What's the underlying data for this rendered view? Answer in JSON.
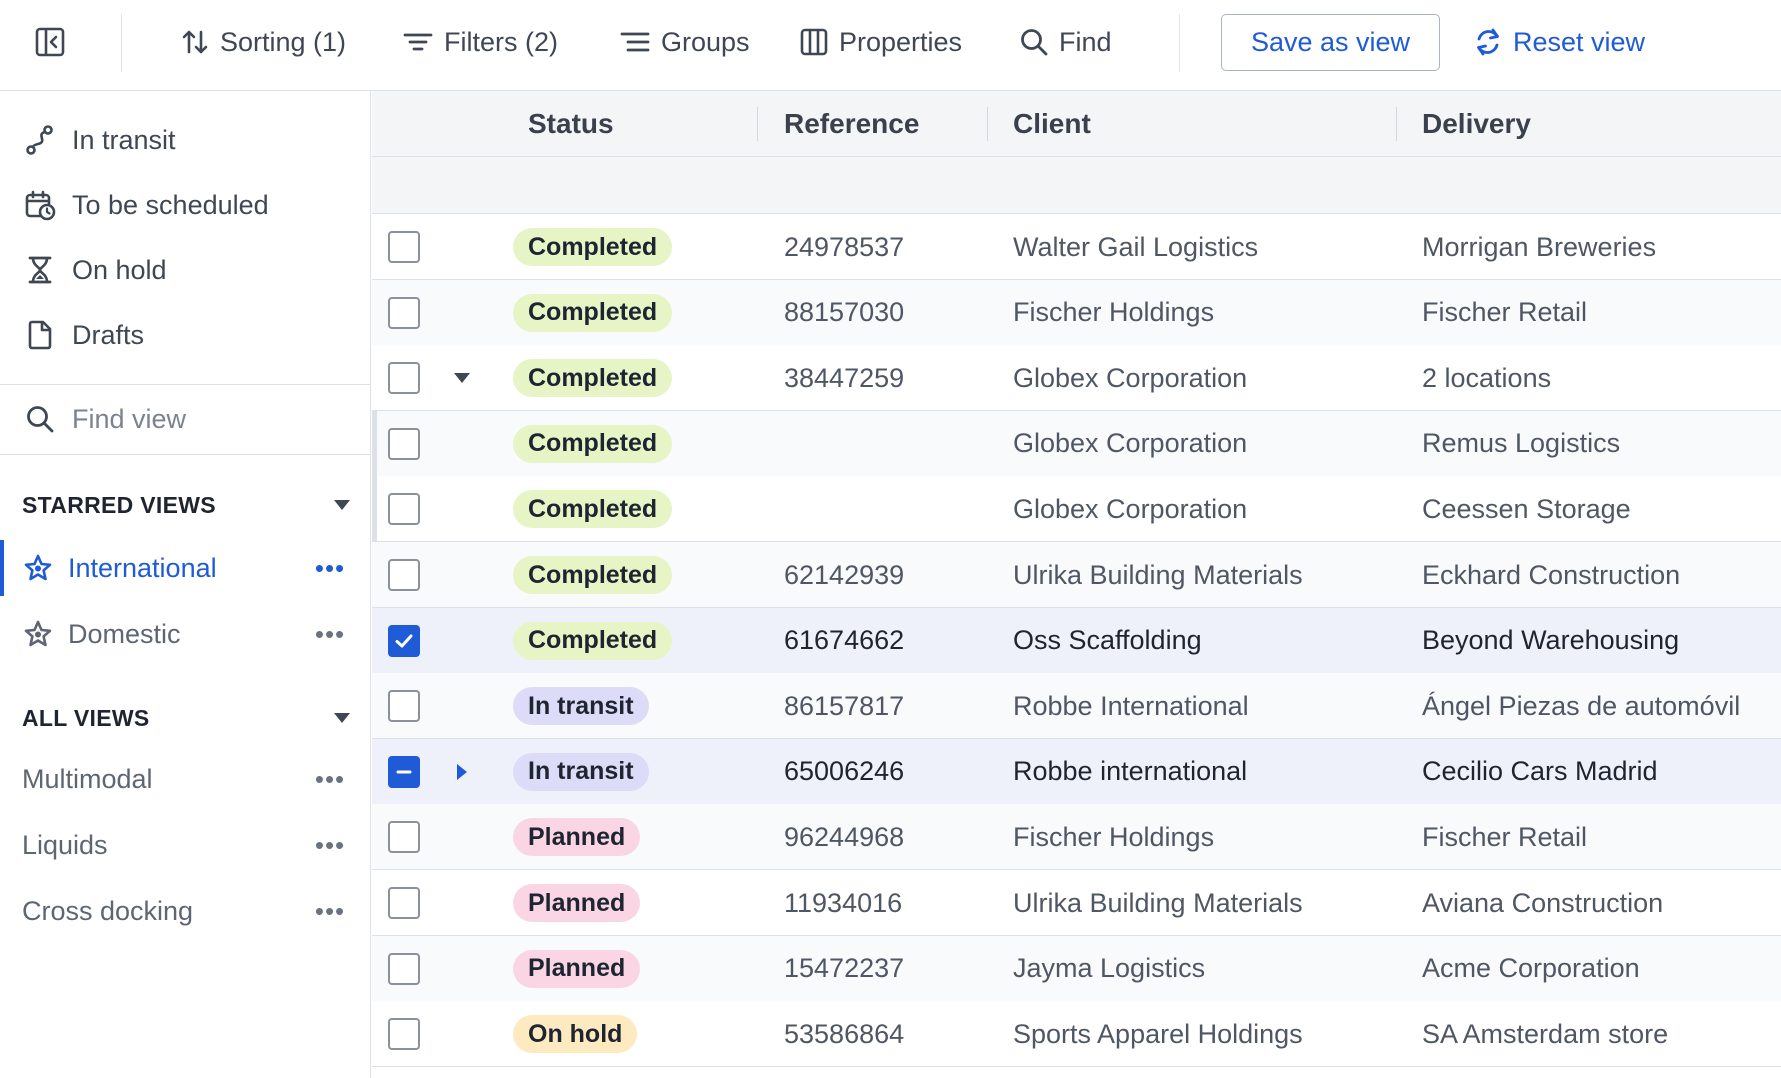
{
  "toolbar": {
    "sorting": "Sorting (1)",
    "filters": "Filters (2)",
    "groups": "Groups",
    "properties": "Properties",
    "find": "Find",
    "save_view": "Save as view",
    "reset_view": "Reset view"
  },
  "sidebar": {
    "nav": [
      {
        "label": "In transit",
        "icon": "route-icon"
      },
      {
        "label": "To be scheduled",
        "icon": "calendar-clock-icon"
      },
      {
        "label": "On hold",
        "icon": "hourglass-icon"
      },
      {
        "label": "Drafts",
        "icon": "document-icon"
      }
    ],
    "find_placeholder": "Find view",
    "starred_heading": "STARRED VIEWS",
    "starred": [
      {
        "label": "International",
        "active": true
      },
      {
        "label": "Domestic",
        "active": false
      }
    ],
    "all_heading": "ALL VIEWS",
    "all": [
      {
        "label": "Multimodal"
      },
      {
        "label": "Liquids"
      },
      {
        "label": "Cross docking"
      }
    ],
    "more_glyph": "•••"
  },
  "table": {
    "columns": [
      "Status",
      "Reference",
      "Client",
      "Delivery"
    ],
    "status_colors": {
      "Completed": "#e6f4c6",
      "In transit": "#dcdcf8",
      "Planned": "#fad6e5",
      "On hold": "#feeac0"
    },
    "rows": [
      {
        "status": "Completed",
        "reference": "24978537",
        "client": "Walter Gail Logistics",
        "delivery": "Morrigan Breweries",
        "checked": "none",
        "expander": "",
        "child": false,
        "selected": false
      },
      {
        "status": "Completed",
        "reference": "88157030",
        "client": "Fischer Holdings",
        "delivery": "Fischer Retail",
        "checked": "none",
        "expander": "",
        "child": false,
        "selected": false
      },
      {
        "status": "Completed",
        "reference": "38447259",
        "client": "Globex Corporation",
        "delivery": "2 locations",
        "checked": "none",
        "expander": "down",
        "child": false,
        "selected": false
      },
      {
        "status": "Completed",
        "reference": "",
        "client": "Globex Corporation",
        "delivery": "Remus Logistics",
        "checked": "none",
        "expander": "",
        "child": true,
        "selected": false
      },
      {
        "status": "Completed",
        "reference": "",
        "client": "Globex Corporation",
        "delivery": "Ceessen Storage",
        "checked": "none",
        "expander": "",
        "child": true,
        "selected": false
      },
      {
        "status": "Completed",
        "reference": "62142939",
        "client": "Ulrika Building Materials",
        "delivery": "Eckhard Construction",
        "checked": "none",
        "expander": "",
        "child": false,
        "selected": false
      },
      {
        "status": "Completed",
        "reference": "61674662",
        "client": "Oss Scaffolding",
        "delivery": "Beyond Warehousing",
        "checked": "checked",
        "expander": "",
        "child": false,
        "selected": true
      },
      {
        "status": "In transit",
        "reference": "86157817",
        "client": "Robbe International",
        "delivery": "Ángel Piezas de automóvil",
        "checked": "none",
        "expander": "",
        "child": false,
        "selected": false
      },
      {
        "status": "In transit",
        "reference": "65006246",
        "client": "Robbe international",
        "delivery": "Cecilio Cars Madrid",
        "checked": "indeterminate",
        "expander": "right",
        "child": false,
        "selected": true
      },
      {
        "status": "Planned",
        "reference": "96244968",
        "client": "Fischer Holdings",
        "delivery": "Fischer Retail",
        "checked": "none",
        "expander": "",
        "child": false,
        "selected": false
      },
      {
        "status": "Planned",
        "reference": "11934016",
        "client": "Ulrika Building Materials",
        "delivery": "Aviana Construction",
        "checked": "none",
        "expander": "",
        "child": false,
        "selected": false
      },
      {
        "status": "Planned",
        "reference": "15472237",
        "client": "Jayma Logistics",
        "delivery": "Acme Corporation",
        "checked": "none",
        "expander": "",
        "child": false,
        "selected": false
      },
      {
        "status": "On hold",
        "reference": "53586864",
        "client": "Sports Apparel Holdings",
        "delivery": "SA Amsterdam store",
        "checked": "none",
        "expander": "",
        "child": false,
        "selected": false
      }
    ]
  },
  "colors": {
    "accent": "#1f5bd7",
    "border": "#dde1e7",
    "header_bg": "#f4f5f7",
    "selected_row": "#eef1f9"
  }
}
